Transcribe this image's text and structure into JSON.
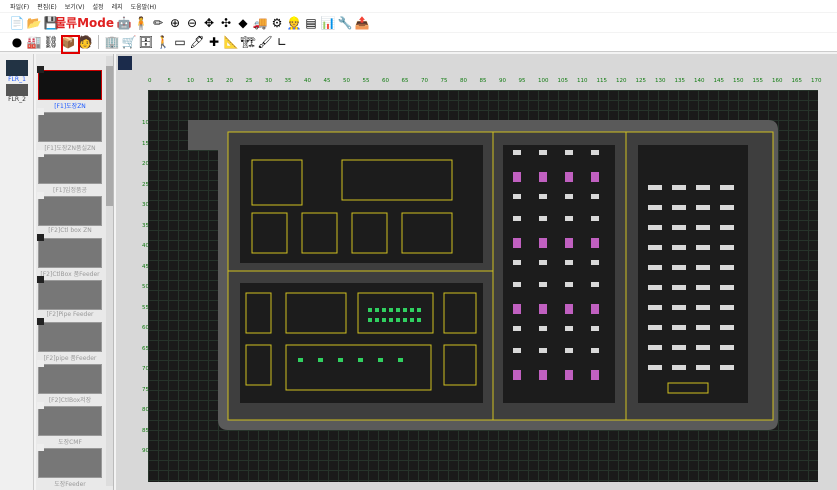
{
  "menu": {
    "items": [
      "파일(F)",
      "편집(E)",
      "보기(V)",
      "설정",
      "레지",
      "도움말(H)"
    ]
  },
  "toolbar": {
    "mode_label": "물류Mode"
  },
  "floors": [
    {
      "label": "FLR_1",
      "active": true
    },
    {
      "label": "FLR_2",
      "active": false
    }
  ],
  "thumbnails": [
    {
      "label": "[F1]도장ZN",
      "selected": true
    },
    {
      "label": "[F1]도장ZN품실ZN",
      "selected": false
    },
    {
      "label": "[F1]임정품공",
      "selected": false
    },
    {
      "label": "[F2]Ctl box ZN",
      "selected": false
    },
    {
      "label": "[F2]CtlBox 품Feeder",
      "selected": false
    },
    {
      "label": "[F2]Pipe Feeder",
      "selected": false
    },
    {
      "label": "[F2]pipe 품Feeder",
      "selected": false
    },
    {
      "label": "[F2]CtlBox저장",
      "selected": false
    },
    {
      "label": "도장CMF",
      "selected": false
    },
    {
      "label": "도장Feeder",
      "selected": false
    }
  ],
  "ruler": {
    "x": [
      "0",
      "5",
      "10",
      "15",
      "20",
      "25",
      "30",
      "35",
      "40",
      "45",
      "50",
      "55",
      "60",
      "65",
      "70",
      "75",
      "80",
      "85",
      "90",
      "95",
      "100",
      "105",
      "110",
      "115",
      "120",
      "125",
      "130",
      "135",
      "140",
      "145",
      "150",
      "155",
      "160",
      "165",
      "170"
    ],
    "y": [
      "10",
      "15",
      "20",
      "25",
      "30",
      "35",
      "40",
      "45",
      "50",
      "55",
      "60",
      "65",
      "70",
      "75",
      "80",
      "85",
      "90"
    ]
  },
  "colors": {
    "plan_bg": "#1a1a1a",
    "zone_line": "#d0c020",
    "aisle": "#555555",
    "highlight": "#e00000"
  }
}
